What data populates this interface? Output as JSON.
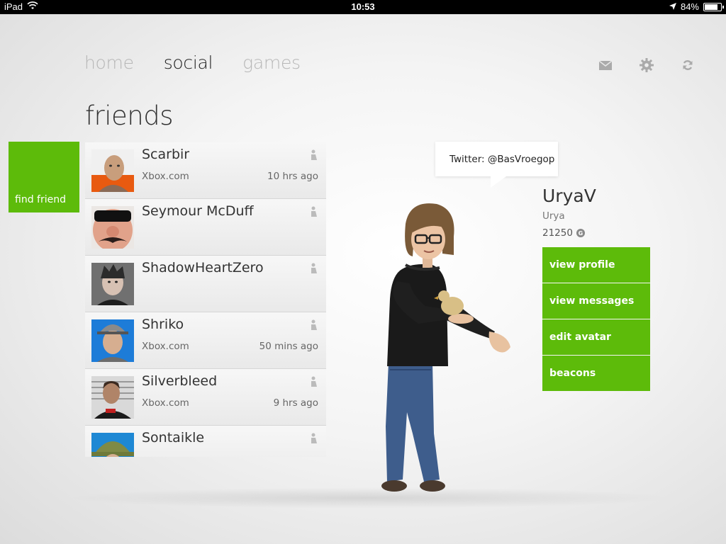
{
  "statusbar": {
    "device": "iPad",
    "time": "10:53",
    "battery": "84%",
    "battery_level": 0.84
  },
  "nav": {
    "tabs": [
      {
        "label": "home",
        "active": false
      },
      {
        "label": "social",
        "active": true
      },
      {
        "label": "games",
        "active": false
      }
    ],
    "icons": [
      "mail-icon",
      "settings-gear-icon",
      "refresh-icon"
    ]
  },
  "section_title": "friends",
  "find_friend_label": "find friend",
  "friends": [
    {
      "name": "Scarbir",
      "source": "Xbox.com",
      "time": "10 hrs ago"
    },
    {
      "name": "Seymour McDuff",
      "source": "",
      "time": ""
    },
    {
      "name": "ShadowHeartZero",
      "source": "",
      "time": ""
    },
    {
      "name": "Shriko",
      "source": "Xbox.com",
      "time": "50 mins ago"
    },
    {
      "name": "Silverbleed",
      "source": "Xbox.com",
      "time": "9 hrs ago"
    },
    {
      "name": "Sontaikle",
      "source": "",
      "time": ""
    }
  ],
  "bubble": {
    "text": "Twitter: @BasVroegop"
  },
  "profile": {
    "gamertag": "UryaV",
    "real_name": "Urya",
    "gamerscore": "21250",
    "gamerscore_badge": "G",
    "actions": [
      "view profile",
      "view messages",
      "edit avatar",
      "beacons"
    ]
  },
  "colors": {
    "accent": "#5dbb0a",
    "nav_inactive": "#b7b7b7",
    "nav_active": "#222222"
  }
}
